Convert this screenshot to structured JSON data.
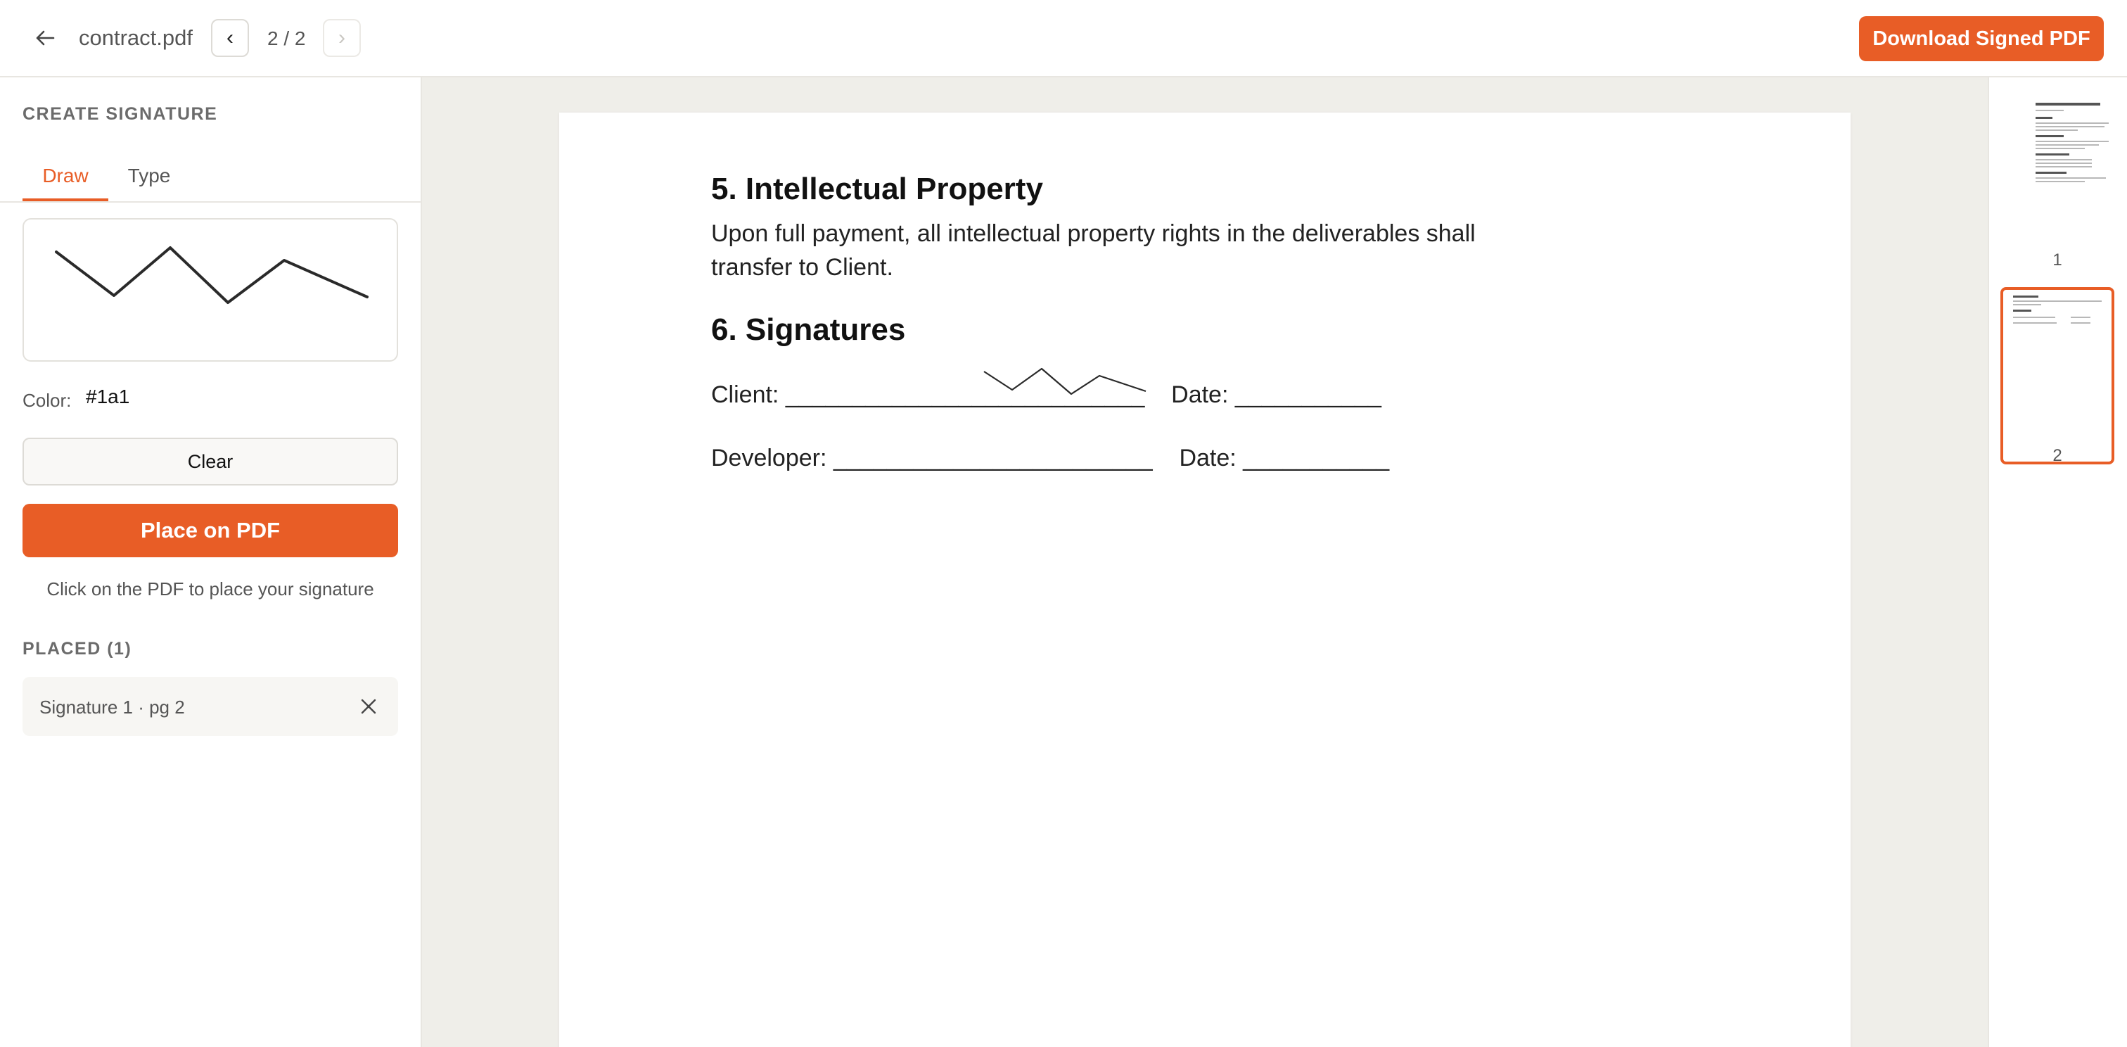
{
  "header": {
    "filename": "contract.pdf",
    "prev_label": "‹",
    "next_label": "›",
    "page_indicator": "2 / 2",
    "download_label": "Download Signed PDF"
  },
  "sidebar": {
    "create_heading": "CREATE SIGNATURE",
    "tabs": [
      {
        "label": "Draw",
        "active": true
      },
      {
        "label": "Type",
        "active": false
      }
    ],
    "color_label": "Color:",
    "color_value": "#1a1",
    "clear_label": "Clear",
    "place_label": "Place on PDF",
    "hint": "Click on the PDF to place your signature",
    "placed_heading": "PLACED (1)",
    "placed_items": [
      {
        "label": "Signature 1 · pg 2"
      }
    ]
  },
  "document": {
    "heading_ip": "5. Intellectual Property",
    "ip_text": "Upon full payment, all intellectual property rights in the deliverables shall transfer to Client.",
    "heading_sig": "6. Signatures",
    "client_line": "Client: ___________________________    Date: ___________",
    "developer_line": "Developer: ________________________    Date: ___________"
  },
  "thumbnails": [
    {
      "label": "1",
      "selected": false
    },
    {
      "label": "2",
      "selected": true
    }
  ],
  "colors": {
    "accent": "#e85d26",
    "viewer_bg": "#efeee9"
  }
}
